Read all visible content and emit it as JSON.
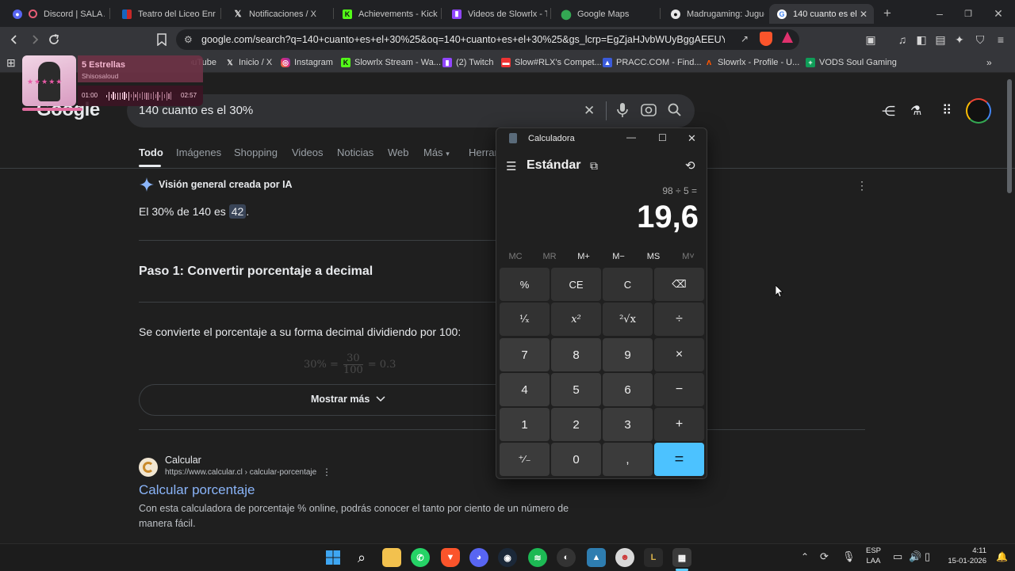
{
  "tabs": [
    {
      "label": "Discord | SALA AD",
      "icon": "discord-icon"
    },
    {
      "label": "Teatro del Liceo Enriq",
      "icon": "theatre-icon"
    },
    {
      "label": "Notificaciones / X",
      "icon": "x-icon"
    },
    {
      "label": "Achievements - Kick",
      "icon": "kick-icon"
    },
    {
      "label": "Videos de Slowrlx - Tw",
      "icon": "twitch-icon"
    },
    {
      "label": "Google Maps",
      "icon": "maps-icon"
    },
    {
      "label": "Madrugaming: Jugue",
      "icon": "github-icon"
    },
    {
      "label": "140 cuanto es el",
      "icon": "google-icon",
      "active": true
    }
  ],
  "toolbar": {
    "url": "google.com/search?q=140+cuanto+es+el+30%25&oq=140+cuanto+es+el+30%25&gs_lcrp=EgZjaHJvbWUyBggAEEUYOTIGC..."
  },
  "bookmarks": [
    {
      "label": "YouTube",
      "icon": "youtube-icon"
    },
    {
      "label": "Inicio / X",
      "icon": "x-icon"
    },
    {
      "label": "Instagram",
      "icon": "instagram-icon"
    },
    {
      "label": "Slowrlx Stream - Wa...",
      "icon": "kick-icon"
    },
    {
      "label": "(2) Twitch",
      "icon": "twitch-icon"
    },
    {
      "label": "Slow#RLX's Compet...",
      "icon": "faceit-icon"
    },
    {
      "label": "PRACC.COM - Find...",
      "icon": "pracc-icon"
    },
    {
      "label": "Slowrlx - Profile - U...",
      "icon": "faceit-icon"
    },
    {
      "label": "VODS Soul Gaming",
      "icon": "sheets-icon"
    }
  ],
  "music": {
    "title": "5 Estrellas",
    "artist": "Shisosaloud",
    "elapsed": "01:00",
    "total": "02:57",
    "progress": 0.34
  },
  "google": {
    "logo": "Google",
    "query": "140 cuanto es el 30%",
    "nav": [
      "Todo",
      "Imágenes",
      "Shopping",
      "Videos",
      "Noticias",
      "Web",
      "Más",
      "Herram"
    ],
    "ai_heading": "Visión general creada por IA",
    "answer_prefix": "El 30% de 140 es",
    "answer_value": "42",
    "answer_suffix": ".",
    "step1_title": "Paso 1: Convertir porcentaje a decimal",
    "step1_text": "Se convierte el porcentaje a su forma decimal dividiendo por 100:",
    "formula_left": "30% =",
    "formula_num": "30",
    "formula_den": "100",
    "formula_right": "= 0.3",
    "show_more": "Mostrar más",
    "result": {
      "site_name": "Calcular",
      "site_url": "https://www.calcular.cl › calcular-porcentaje",
      "title": "Calcular porcentaje",
      "snippet_line1": "Con esta calculadora de porcentaje % online, podrás conocer el tanto por ciento de un número de",
      "snippet_line2": "manera fácil."
    }
  },
  "calculator": {
    "window_title": "Calculadora",
    "mode": "Estándar",
    "expression": "98 ÷ 5 =",
    "display": "19,6",
    "memory": [
      "MC",
      "MR",
      "M+",
      "M−",
      "MS",
      "M˅"
    ],
    "keys": [
      [
        "%",
        "CE",
        "C",
        "⌫"
      ],
      [
        "¹⁄ₓ",
        "x²",
        "²√x",
        "÷"
      ],
      [
        "7",
        "8",
        "9",
        "×"
      ],
      [
        "4",
        "5",
        "6",
        "−"
      ],
      [
        "1",
        "2",
        "3",
        "+"
      ],
      [
        "⁺⁄₋",
        "0",
        ",",
        "="
      ]
    ]
  },
  "taskbar": {
    "language": "ESP",
    "layout": "LAA",
    "time": "4:11",
    "date": "15-01-2026"
  },
  "colors": {
    "accent": "#4cc2ff",
    "link": "#8ab4f8",
    "highlight": "#394457"
  }
}
